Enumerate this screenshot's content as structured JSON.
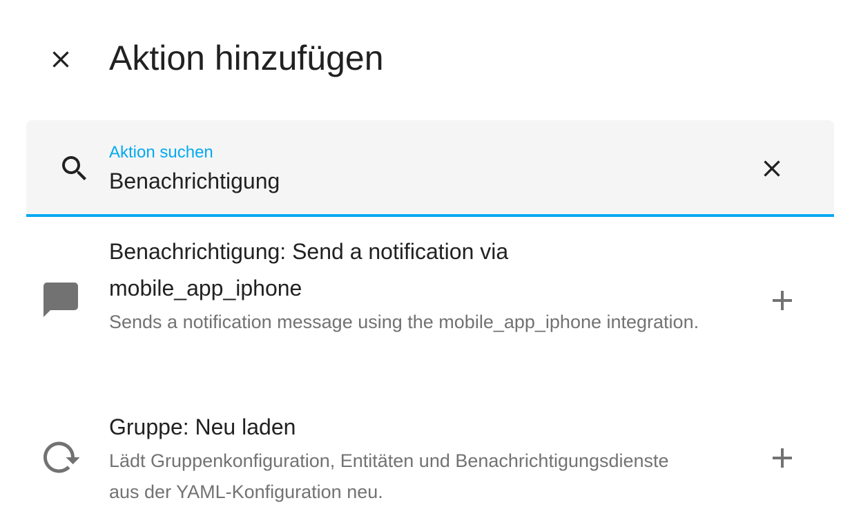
{
  "dialog": {
    "title": "Aktion hinzufügen",
    "close_icon": "close-icon"
  },
  "search": {
    "label": "Aktion suchen",
    "value": "Benachrichtigung",
    "icon": "magnify-icon",
    "clear_icon": "close-icon",
    "accent_color": "#03a9f4"
  },
  "results": [
    {
      "icon": "message-icon",
      "title": "Benachrichtigung: Send a notification via mobile_app_iphone",
      "description": "Sends a notification message using the mobile_app_iphone integration.",
      "add_icon": "plus-icon"
    },
    {
      "icon": "reload-icon",
      "title": "Gruppe: Neu laden",
      "description": "Lädt Gruppenkonfiguration, Entitäten und Benachrichtigungsdienste aus der YAML-Konfiguration neu.",
      "add_icon": "plus-icon"
    }
  ]
}
